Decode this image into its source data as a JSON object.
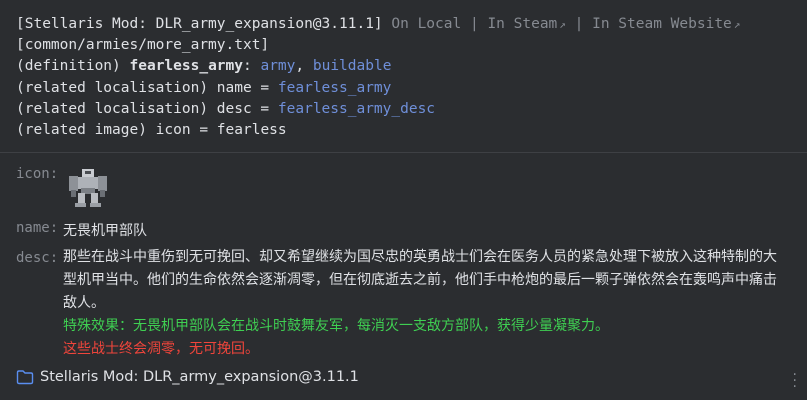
{
  "header": {
    "mod_tag": "[Stellaris Mod: DLR_army_expansion@3.11.1]",
    "on_local": "On Local",
    "sep1": " | ",
    "in_steam": "In Steam",
    "sep2": " | ",
    "in_steam_website": "In Steam Website",
    "external_arrow": "↗",
    "file_path": "[common/armies/more_army.txt]",
    "definition": {
      "prefix": "(definition) ",
      "name": "fearless_army",
      "colon": ": ",
      "type": "army",
      "comma": ", ",
      "tag": "buildable"
    },
    "loc_name": {
      "prefix": "(related localisation) name = ",
      "value": "fearless_army"
    },
    "loc_desc": {
      "prefix": "(related localisation) desc = ",
      "value": "fearless_army_desc"
    },
    "image": {
      "prefix": "(related image) icon = ",
      "value": "fearless"
    }
  },
  "fields": {
    "icon_label": "icon:",
    "name_label": "name:",
    "name_value": "无畏机甲部队",
    "desc_label": "desc:",
    "desc_text": "那些在战斗中重伤到无可挽回、却又希望继续为国尽忠的英勇战士们会在医务人员的紧急处理下被放入这种特制的大型机甲当中。他们的生命依然会逐渐凋零，但在彻底逝去之前，他们手中枪炮的最后一颗子弹依然会在轰鸣声中痛击敌人。",
    "desc_effect": "特殊效果：无畏机甲部队会在战斗时鼓舞友军，每消灭一支敌方部队，获得少量凝聚力。",
    "desc_warning": "这些战士终会凋零，无可挽回。"
  },
  "footer": {
    "mod_label": "Stellaris Mod: DLR_army_expansion@3.11.1"
  },
  "icons": {
    "folder": "folder-icon",
    "more": "more-vertical-icon",
    "mech": "mech-army-icon"
  },
  "colors": {
    "background": "#2b2d30",
    "link": "#6f8fd9",
    "muted": "#868a91",
    "effect_green": "#3fcf52",
    "warning_red": "#f0453b"
  }
}
